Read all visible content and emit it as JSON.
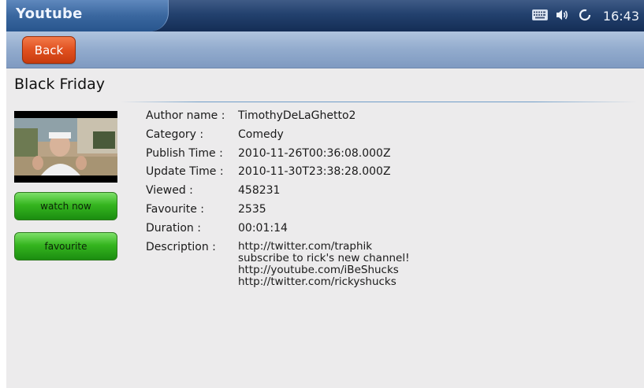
{
  "statusbar": {
    "app_title": "Youtube",
    "time": "16:43",
    "icons": [
      "keyboard-icon",
      "volume-icon",
      "sync-icon"
    ]
  },
  "toolbar": {
    "back_label": "Back"
  },
  "video": {
    "title": "Black Friday",
    "watch_label": "watch now",
    "favourite_label": "favourite"
  },
  "details": {
    "author": {
      "label": "Author name :",
      "value": "TimothyDeLaGhetto2"
    },
    "category": {
      "label": "Category :",
      "value": "Comedy"
    },
    "publish": {
      "label": "Publish Time :",
      "value": "2010-11-26T00:36:08.000Z"
    },
    "update": {
      "label": "Update Time :",
      "value": "2010-11-30T23:38:28.000Z"
    },
    "viewed": {
      "label": "Viewed :",
      "value": "458231"
    },
    "favourite": {
      "label": "Favourite :",
      "value": "2535"
    },
    "duration": {
      "label": "Duration :",
      "value": "00:01:14"
    },
    "description": {
      "label": "Description :",
      "lines": [
        "http://twitter.com/traphik",
        "subscribe to rick's new channel!",
        "http://youtube.com/iBeShucks",
        "http://twitter.com/rickyshucks"
      ]
    }
  },
  "colors": {
    "topbar": "#23416e",
    "toolbar": "#92abcd",
    "back_button": "#e0501f",
    "green_button": "#35b51f",
    "background": "#ecebec"
  }
}
